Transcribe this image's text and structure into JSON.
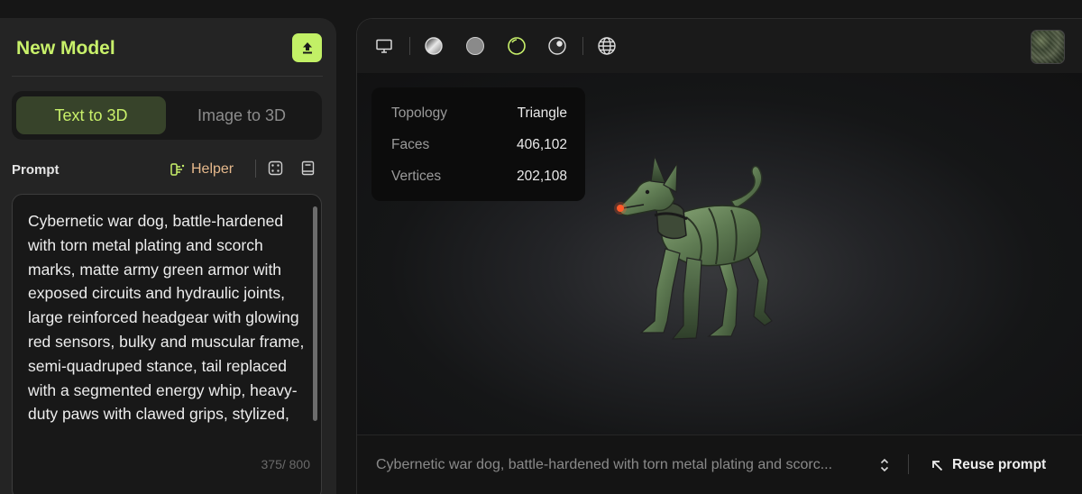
{
  "left_panel": {
    "title": "New Model",
    "upload_icon": "upload-icon",
    "tabs": [
      {
        "label": "Text to 3D",
        "active": true
      },
      {
        "label": "Image to 3D",
        "active": false
      }
    ],
    "prompt_label": "Prompt",
    "helper_label": "Helper",
    "helper_icon": "helper-icon",
    "dice_icon": "dice-icon",
    "book_icon": "book-icon",
    "prompt_text": "Cybernetic war dog, battle-hardened with torn metal plating and scorch marks, matte army green armor with exposed circuits and hydraulic joints, large reinforced headgear with glowing red sensors, bulky and muscular frame, semi-quadruped stance, tail replaced with a segmented energy whip, heavy-duty paws with clawed grips, stylized,",
    "char_count": "375/ 800"
  },
  "viewer": {
    "toolbar_icons": [
      "monitor-icon",
      "shaded-sphere-icon",
      "solid-sphere-icon",
      "wireframe-ring-icon",
      "dual-sphere-icon",
      "globe-icon"
    ],
    "active_icon": "wireframe-ring-icon",
    "stats": [
      {
        "label": "Topology",
        "value": "Triangle"
      },
      {
        "label": "Faces",
        "value": "406,102"
      },
      {
        "label": "Vertices",
        "value": "202,108"
      }
    ],
    "footer_prompt": "Cybernetic war dog, battle-hardened with torn metal plating and scorc...",
    "reuse_label": "Reuse prompt"
  },
  "colors": {
    "accent": "#c8f06a",
    "panel": "#242424",
    "background": "#161616"
  }
}
